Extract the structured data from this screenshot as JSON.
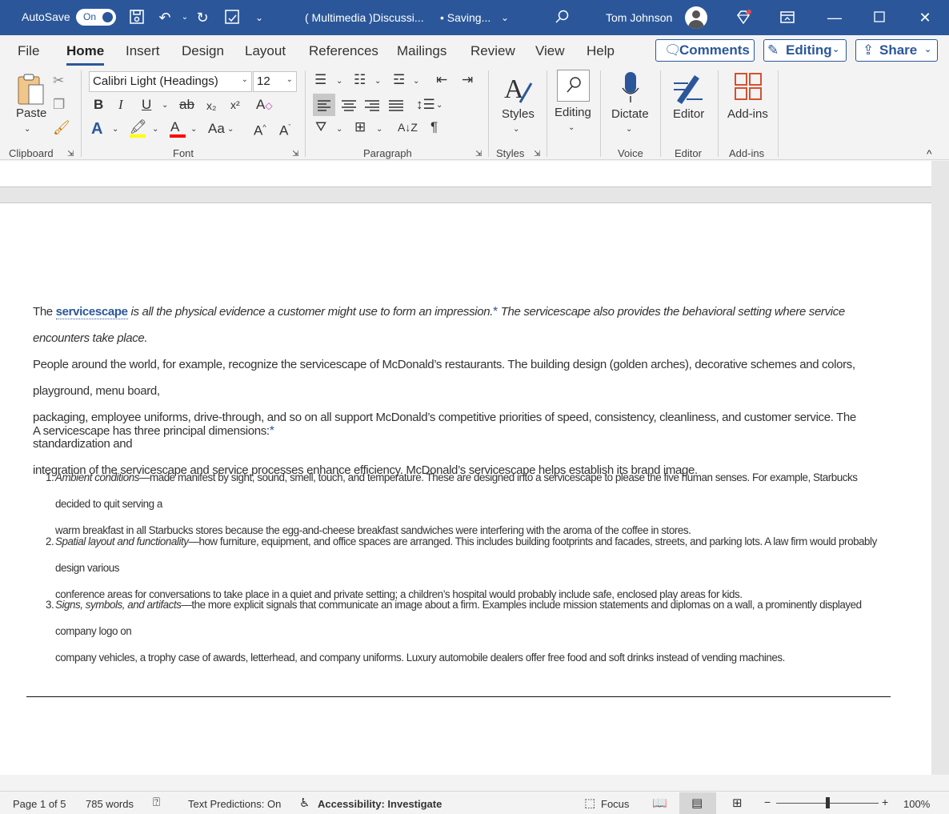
{
  "titlebar": {
    "autosave_label": "AutoSave",
    "autosave_state": "On",
    "doc_title": "( Multimedia )Discussi...",
    "status": "• Saving...",
    "user_name": "Tom Johnson"
  },
  "menu": {
    "tabs": [
      "File",
      "Home",
      "Insert",
      "Design",
      "Layout",
      "References",
      "Mailings",
      "Review",
      "View",
      "Help"
    ],
    "active": "Home",
    "comments_label": "Comments",
    "editing_label": "Editing",
    "share_label": "Share"
  },
  "ribbon": {
    "clipboard": {
      "paste_label": "Paste",
      "group_label": "Clipboard"
    },
    "font": {
      "font_name": "Calibri Light (Headings)",
      "font_size": "12",
      "group_label": "Font",
      "bold": "B",
      "italic": "I",
      "underline": "U",
      "strike": "ab",
      "sub": "x₂",
      "sup": "x²",
      "case": "Aa"
    },
    "paragraph": {
      "group_label": "Paragraph"
    },
    "styles": {
      "label": "Styles",
      "group_label": "Styles"
    },
    "editing": {
      "label": "Editing"
    },
    "voice": {
      "label": "Dictate",
      "group_label": "Voice"
    },
    "editor": {
      "label": "Editor",
      "group_label": "Editor"
    },
    "addins": {
      "label": "Add-ins",
      "group_label": "Add-ins"
    },
    "accent_color": "#2b579a",
    "highlight_color": "#ffff00",
    "font_color": "#ff0000"
  },
  "document": {
    "p1_a": "The ",
    "p1_keyword": "servicescape",
    "p1_b": " is all the physical evidence a customer might use to form an impression.",
    "p1_c": " The servicescape also provides the behavioral setting where service encounters take place.",
    "p1_d": "People around the world, for example, recognize the servicescape of McDonald’s restaurants. The building design (golden arches), decorative schemes and colors, playground, menu board,",
    "p1_e": "packaging, employee uniforms, drive-through, and so on all support McDonald’s competitive priorities of speed, consistency, cleanliness, and customer service. The standardization and",
    "p1_f": "integration of the servicescape and service processes enhance efficiency. McDonald’s servicescape helps establish its brand image.",
    "p2": "A servicescape has three principal dimensions:",
    "asterisk": "*",
    "items": [
      {
        "num": "1.",
        "title": "Ambient conditions",
        "line1": "—made manifest by sight, sound, smell, touch, and temperature. These are designed into a servicescape to please the five human senses. For example, Starbucks decided to quit serving a",
        "line2": "warm breakfast in all Starbucks stores because the egg-and-cheese breakfast sandwiches were interfering with the aroma of the coffee in stores."
      },
      {
        "num": "2.",
        "title": "Spatial layout and functionality",
        "line1": "—how furniture, equipment, and office spaces are arranged. This includes building footprints and facades, streets, and parking lots. A law firm would probably design various",
        "line2": "conference areas for conversations to take place in a quiet and private setting; a children’s hospital would probably include safe, enclosed play areas for kids."
      },
      {
        "num": "3.",
        "title": "Signs, symbols, and artifacts",
        "line1": "—the more explicit signals that communicate an image about a firm. Examples include mission statements and diplomas on a wall, a prominently displayed company logo on",
        "line2": "company vehicles, a trophy case of awards, letterhead, and company uniforms. Luxury automobile dealers offer free food and soft drinks instead of vending machines."
      }
    ]
  },
  "statusbar": {
    "page": "Page 1 of 5",
    "words": "785 words",
    "predictions": "Text Predictions: On",
    "accessibility": "Accessibility: Investigate",
    "focus": "Focus",
    "zoom": "100%"
  }
}
